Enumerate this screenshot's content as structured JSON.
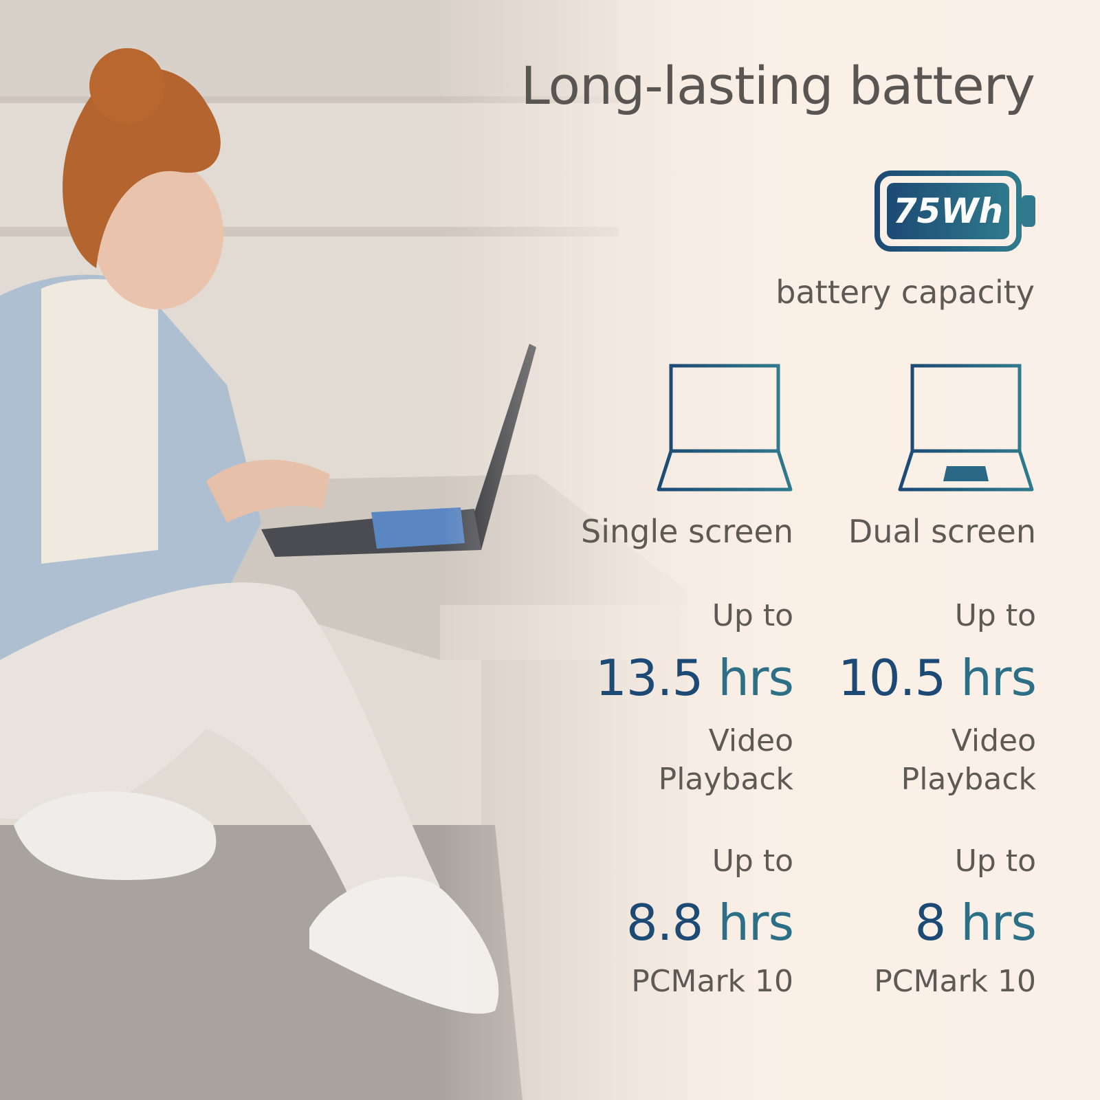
{
  "colors": {
    "accent_dark_blue": "#1c4a74",
    "accent_teal": "#2c6f86",
    "text_gray": "#5d5955",
    "background_cream": "#faf0e7"
  },
  "photo": {
    "icon": "woman-with-laptop-photo"
  },
  "title": "Long-lasting battery",
  "battery": {
    "badge_text": "75Wh",
    "caption": "battery capacity",
    "icon": "battery-icon"
  },
  "modes": [
    {
      "label": "Single screen",
      "icon": "laptop-single-screen-icon",
      "video": {
        "prefix": "Up to",
        "value": "13.5",
        "unit": "hrs",
        "line1": "Video",
        "line2": "Playback"
      },
      "pcmark": {
        "prefix": "Up to",
        "value": "8.8",
        "unit": "hrs",
        "label": "PCMark 10"
      }
    },
    {
      "label": "Dual screen",
      "icon": "laptop-dual-screen-icon",
      "video": {
        "prefix": "Up to",
        "value": "10.5",
        "unit": "hrs",
        "line1": "Video",
        "line2": "Playback"
      },
      "pcmark": {
        "prefix": "Up to",
        "value": "8",
        "unit": "hrs",
        "label": "PCMark 10"
      }
    }
  ]
}
